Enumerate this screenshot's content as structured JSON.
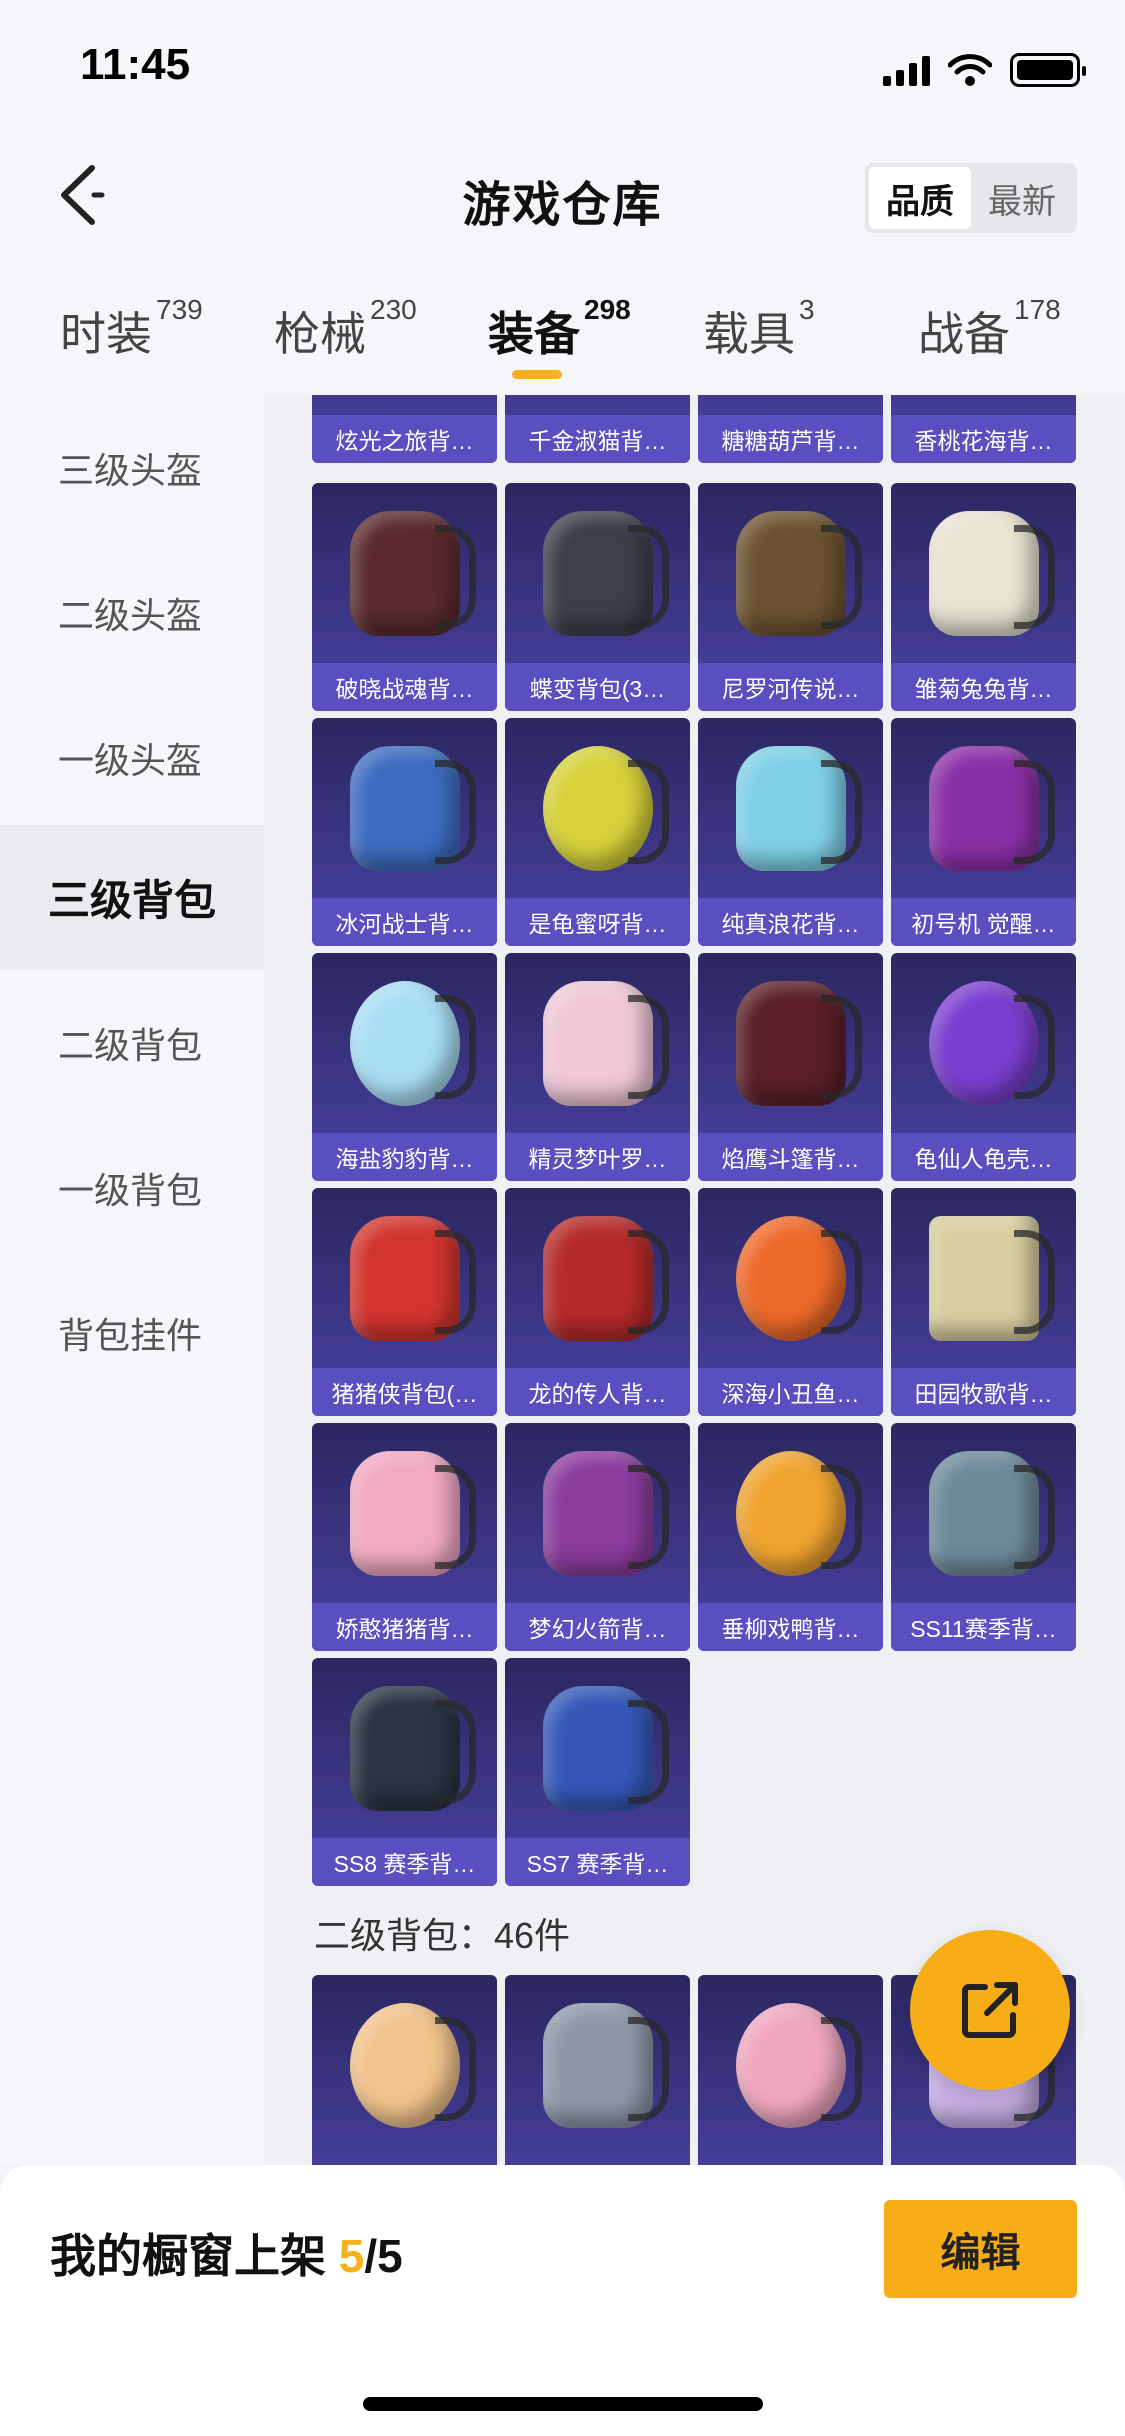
{
  "status_bar": {
    "time": "11:45"
  },
  "header": {
    "title": "游戏仓库",
    "sort_options": [
      "品质",
      "最新"
    ],
    "active_sort": "品质"
  },
  "tabs": [
    {
      "label": "时装",
      "count": "739"
    },
    {
      "label": "枪械",
      "count": "230"
    },
    {
      "label": "装备",
      "count": "298"
    },
    {
      "label": "载具",
      "count": "3"
    },
    {
      "label": "战备",
      "count": "178"
    }
  ],
  "active_tab": "装备",
  "sidebar": {
    "items": [
      "三级头盔",
      "二级头盔",
      "一级头盔",
      "三级背包",
      "二级背包",
      "一级背包",
      "背包挂件"
    ],
    "active": "三级背包"
  },
  "grid": {
    "row0": [
      "炫光之旅背…",
      "千金淑猫背…",
      "糖糖葫芦背…",
      "香桃花海背…"
    ],
    "row1": [
      "破晓战魂背…",
      "蝶变背包(3…",
      "尼罗河传说…",
      "雏菊兔兔背…"
    ],
    "row2": [
      "冰河战士背…",
      "是龟蜜呀背…",
      "纯真浪花背…",
      "初号机 觉醒…"
    ],
    "row3": [
      "海盐豹豹背…",
      "精灵梦叶罗…",
      "焰鹰斗篷背…",
      "龟仙人龟壳…"
    ],
    "row4": [
      "猪猪侠背包(…",
      "龙的传人背…",
      "深海小丑鱼…",
      "田园牧歌背…"
    ],
    "row5": [
      "娇憨猪猪背…",
      "梦幻火箭背…",
      "垂柳戏鸭背…",
      "SS11赛季背…"
    ],
    "row6": [
      "SS8 赛季背…",
      "SS7 赛季背…"
    ]
  },
  "section2": {
    "label": "二级背包：46件"
  },
  "bottom_bar": {
    "label": "我的橱窗上架",
    "count": "5",
    "total": "/5",
    "edit_label": "编辑"
  },
  "colors": {
    "accent": "#f6ad16",
    "card_top": "#2b2760",
    "card_bottom": "#4b43a6",
    "name_strip": "#5a4fc0"
  }
}
